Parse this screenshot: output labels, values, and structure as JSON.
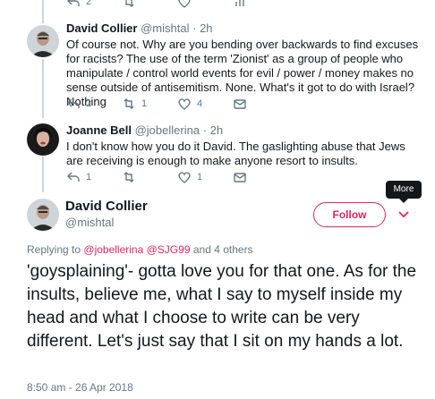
{
  "top_actions": {
    "reply_count": "2"
  },
  "replies": [
    {
      "name": "David Collier",
      "handle": "@mishtal",
      "time": "2h",
      "text": "Of course not. Why are you bending over backwards to find excuses for racists? The use of the term 'Zionist' as a group of people who manipulate / control world events for evil / power / money makes no sense outside of antisemitism. None. What's it got to do with Israel? Nothing",
      "reply_count": "2",
      "retweet_count": "1",
      "like_count": "4"
    },
    {
      "name": "Joanne Bell",
      "handle": "@jobellerina",
      "time": "2h",
      "text": "I don't know how you do it David. The gaslighting abuse that Jews are receiving is enough to make anyone  resort to insults.",
      "reply_count": "1",
      "retweet_count": "",
      "like_count": "1"
    }
  ],
  "main_tweet": {
    "name": "David Collier",
    "handle": "@mishtal",
    "follow_label": "Follow",
    "tooltip": "More",
    "replying_prefix": "Replying to",
    "replying_user1": "@jobellerina",
    "replying_user2": "@SJG99",
    "replying_suffix": "and 4 others",
    "text": "'goysplaining'- gotta love you for that one. As for the insults, believe me, what I say to myself inside my head and what I choose to write can be very different. Let's just say that I sit on my hands a lot.",
    "timestamp": "8:50 am - 26 Apr 2018"
  },
  "colors": {
    "accent": "#e0245e",
    "muted": "#657786",
    "line": "#ccd6dd"
  }
}
